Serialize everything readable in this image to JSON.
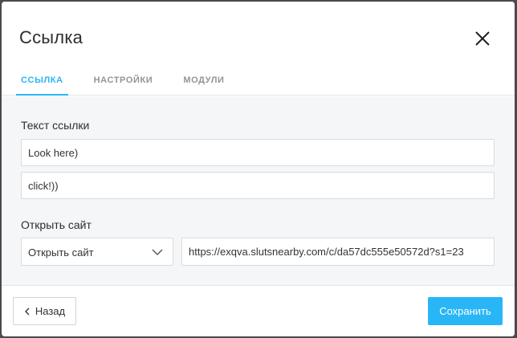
{
  "dialog": {
    "title": "Ссылка"
  },
  "tabs": [
    {
      "label": "Ссылка",
      "active": true
    },
    {
      "label": "Настройки",
      "active": false
    },
    {
      "label": "Модули",
      "active": false
    }
  ],
  "link_text": {
    "label": "Текст ссылки",
    "line1_value": "Look here)",
    "line2_value": "click!))"
  },
  "open_site": {
    "label": "Открыть сайт",
    "select_value": "Открыть сайт",
    "url_value": "https://exqva.slutsnearby.com/c/da57dc555e50572d?s1=23"
  },
  "footer": {
    "back_label": "Назад",
    "save_label": "Сохранить"
  },
  "colors": {
    "accent": "#29b6f6",
    "body_bg": "#f5f6f7"
  },
  "icons": {
    "close": "close-icon",
    "select": "chevron-down-icon",
    "back": "chevron-left-icon"
  }
}
